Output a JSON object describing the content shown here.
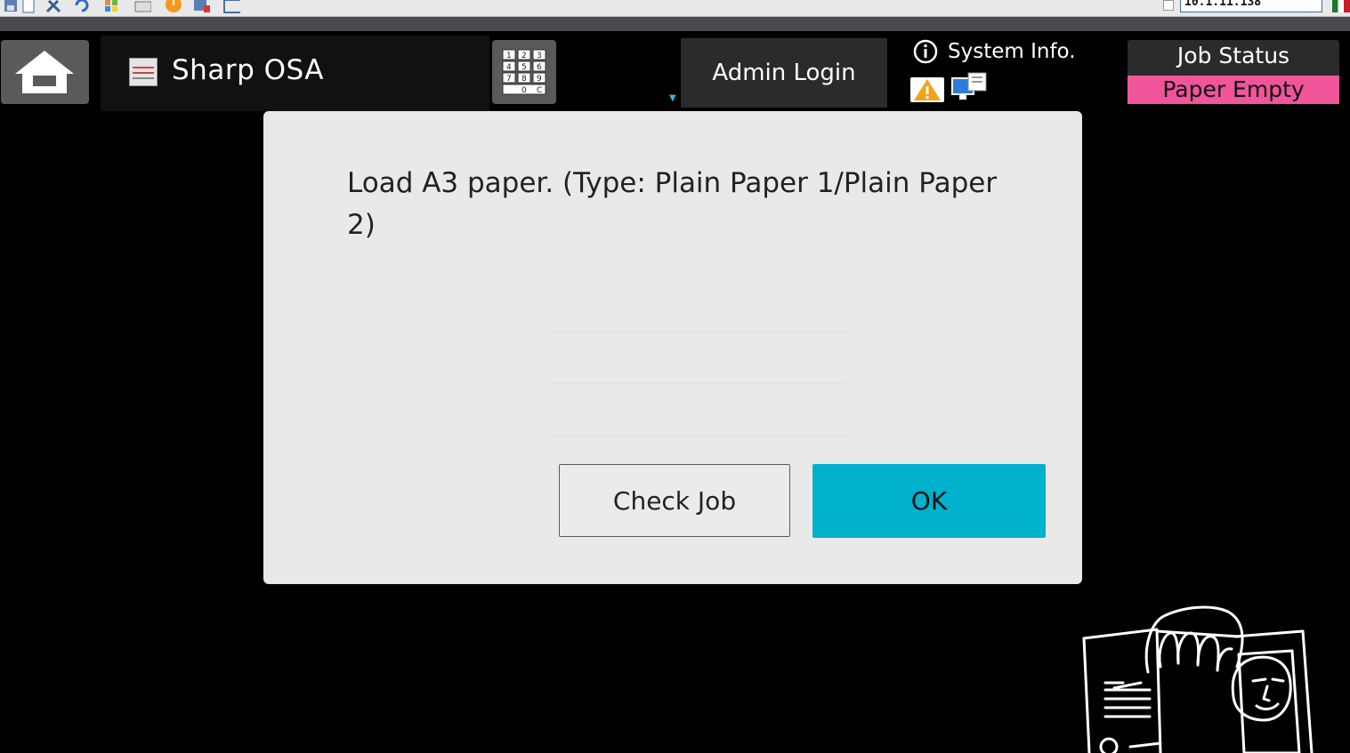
{
  "viewer": {
    "address": "10.1.11.138"
  },
  "topbar": {
    "app_title": "Sharp OSA",
    "admin_login_label": "Admin Login",
    "system_info_label": "System Info.",
    "job_status_label": "Job Status",
    "job_status_badge": "Paper Empty"
  },
  "dialog": {
    "message": "Load A3 paper. (Type: Plain Paper 1/Plain Paper 2)",
    "check_job_label": "Check Job",
    "ok_label": "OK"
  },
  "colors": {
    "accent": "#00b1cc",
    "status_badge": "#f0559a",
    "dialog_bg": "#e9e9e9"
  },
  "icons": [
    "home-icon",
    "keypad-icon",
    "info-icon",
    "warning-icon",
    "network-icon",
    "app-icon"
  ]
}
